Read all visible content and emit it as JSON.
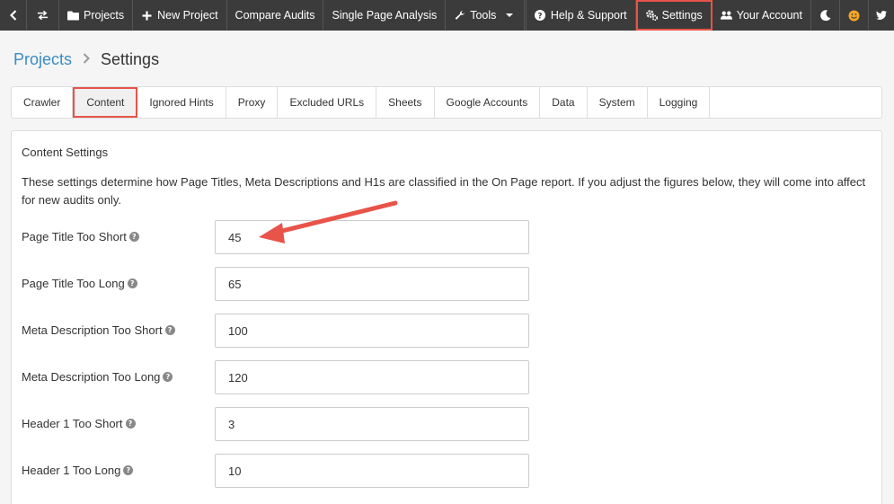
{
  "nav": {
    "projects": "Projects",
    "new_project": "New Project",
    "compare_audits": "Compare Audits",
    "single_page_analysis": "Single Page Analysis",
    "tools": "Tools",
    "help_support": "Help & Support",
    "settings": "Settings",
    "your_account": "Your Account"
  },
  "breadcrumb": {
    "root": "Projects",
    "current": "Settings"
  },
  "tabs": [
    {
      "label": "Crawler"
    },
    {
      "label": "Content"
    },
    {
      "label": "Ignored Hints"
    },
    {
      "label": "Proxy"
    },
    {
      "label": "Excluded URLs"
    },
    {
      "label": "Sheets"
    },
    {
      "label": "Google Accounts"
    },
    {
      "label": "Data"
    },
    {
      "label": "System"
    },
    {
      "label": "Logging"
    }
  ],
  "active_tab": "Content",
  "content": {
    "title": "Content Settings",
    "description": "These settings determine how Page Titles, Meta Descriptions and H1s are classified in the On Page report. If you adjust the figures below, they will come into affect for new audits only.",
    "fields": [
      {
        "label": "Page Title Too Short",
        "value": "45"
      },
      {
        "label": "Page Title Too Long",
        "value": "65"
      },
      {
        "label": "Meta Description Too Short",
        "value": "100"
      },
      {
        "label": "Meta Description Too Long",
        "value": "120"
      },
      {
        "label": "Header 1 Too Short",
        "value": "3"
      },
      {
        "label": "Header 1 Too Long",
        "value": "10"
      }
    ]
  },
  "colors": {
    "nav_bg": "#3b3b3b",
    "highlight": "#e8534a",
    "link": "#3a8cc4"
  },
  "icons": {
    "back": "chevron-left-icon",
    "swap": "swap-arrows-icon",
    "projects": "folder-icon",
    "new_project": "plus-icon",
    "tools": "wrench-icon",
    "help": "question-circle-icon",
    "settings": "gears-icon",
    "account": "users-icon",
    "theme": "moon-icon",
    "emoji": "smiley-icon",
    "social": "twitter-icon",
    "field_help": "question-circle-icon"
  }
}
